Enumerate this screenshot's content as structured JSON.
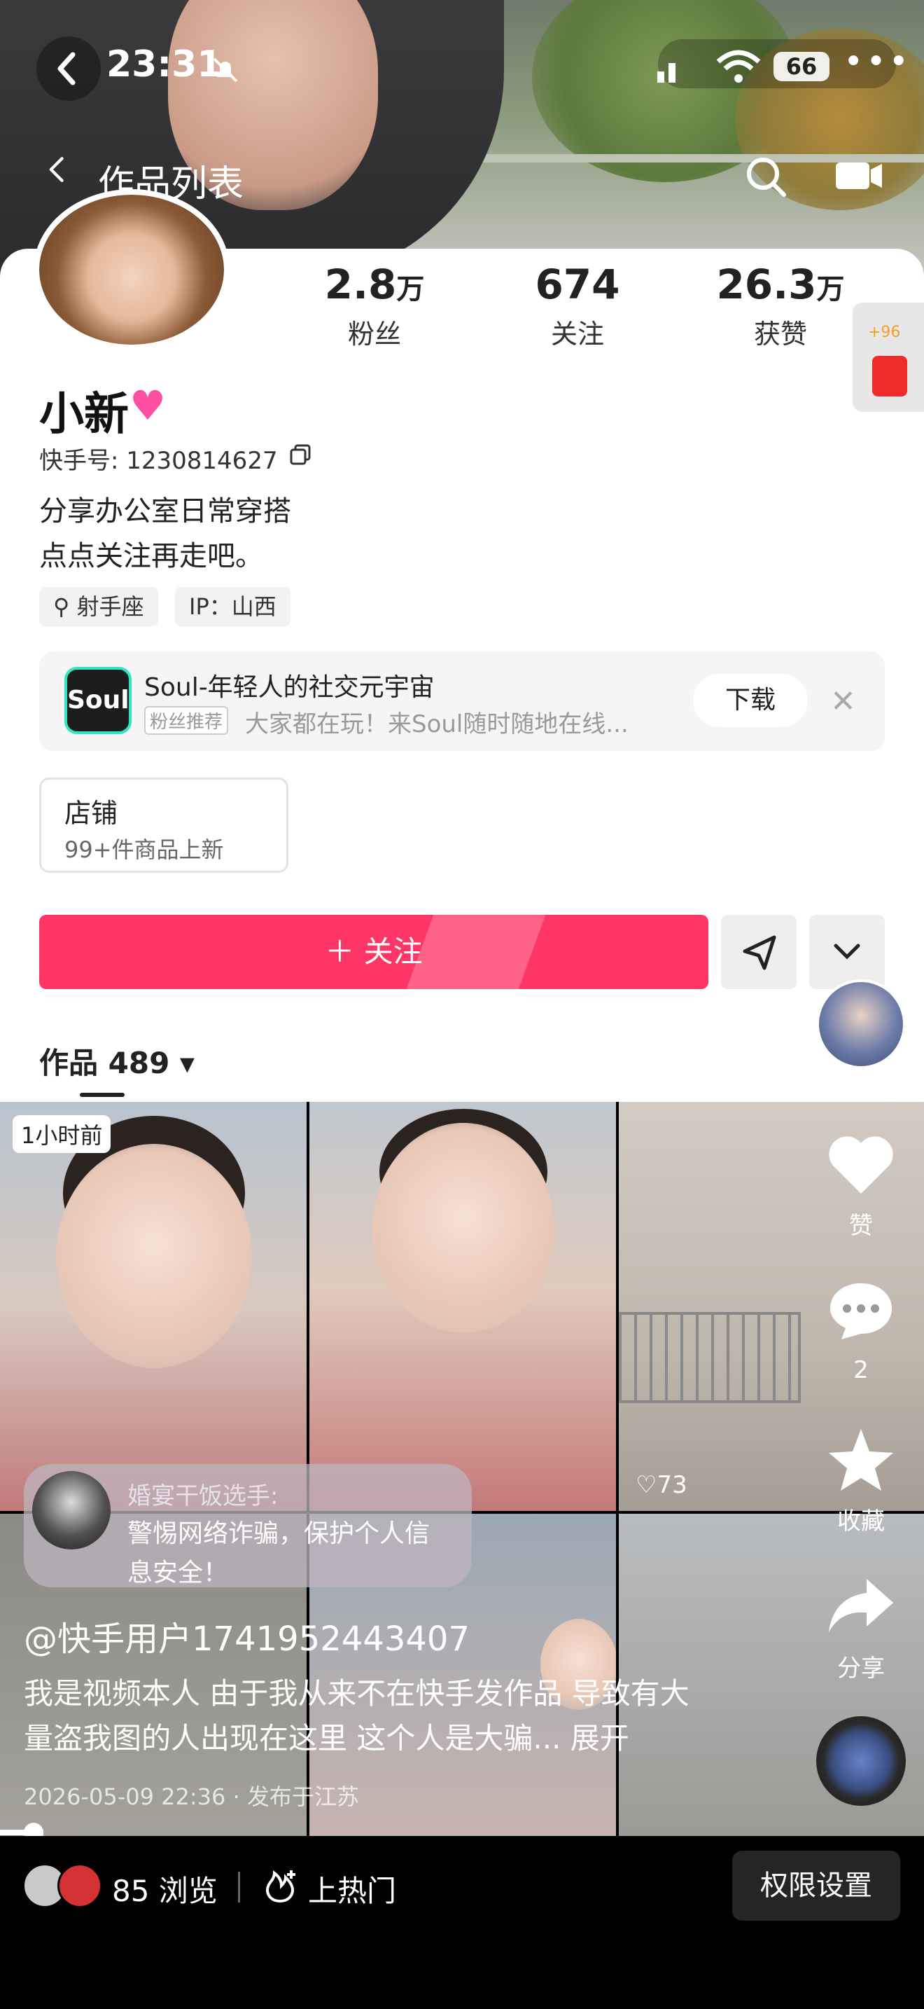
{
  "status_bar": {
    "time": "23:31",
    "battery": "66"
  },
  "nav": {
    "title": "作品列表"
  },
  "profile": {
    "stats": [
      {
        "num": "2.8",
        "unit": "万",
        "label": "粉丝"
      },
      {
        "num": "674",
        "unit": "",
        "label": "关注"
      },
      {
        "num": "26.3",
        "unit": "万",
        "label": "获赞"
      }
    ],
    "redpacket_plus": "+96",
    "name": "小新",
    "kuaishou_id": "快手号: 1230814627",
    "bio_line1": "分享办公室日常穿搭",
    "bio_line2": "点点关注再走吧。",
    "tags": [
      "射手座",
      "IP：山西"
    ]
  },
  "ad": {
    "logo_text": "Soul",
    "title": "Soul-年轻人的社交元宇宙",
    "badge": "粉丝推荐",
    "desc": "大家都在玩！来Soul随时随地在线...",
    "download": "下载"
  },
  "shop": {
    "title": "店铺",
    "sub": "99+件商品上新"
  },
  "follow": {
    "label": "关注"
  },
  "works": {
    "label": "作品 489"
  },
  "grid": {
    "time_badge": "1小时前",
    "like_count": "73"
  },
  "actions": [
    {
      "icon": "heart-icon",
      "label": "赞"
    },
    {
      "icon": "comment-icon",
      "label": "2"
    },
    {
      "icon": "star-icon",
      "label": "收藏"
    },
    {
      "icon": "share-icon",
      "label": "分享"
    }
  ],
  "notice": {
    "name": "婚宴干饭选手:",
    "text": "警惕网络诈骗，保护个人信息安全！"
  },
  "video": {
    "user_handle": "@快手用户1741952443407",
    "desc": "我是视频本人 由于我从来不在快手发作品 导致有大量盗我图的人出现在这里 这个人是大骗... 展开",
    "date": "2026-05-09 22:36 · 发布于江苏",
    "progress": 0.05
  },
  "bottom_bar": {
    "views": "85 浏览",
    "hot": "上热门",
    "permission": "权限设置"
  }
}
